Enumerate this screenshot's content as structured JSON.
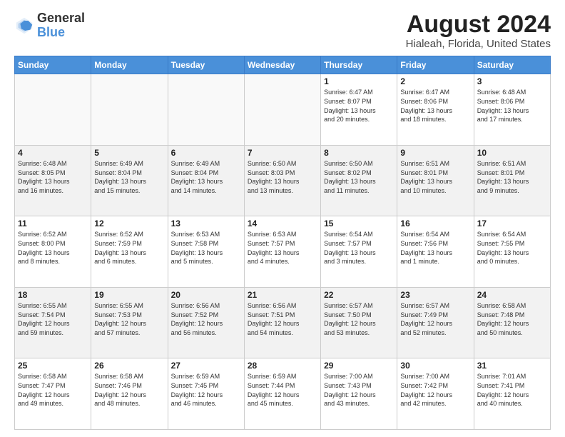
{
  "logo": {
    "line1": "General",
    "line2": "Blue"
  },
  "title": "August 2024",
  "subtitle": "Hialeah, Florida, United States",
  "days_of_week": [
    "Sunday",
    "Monday",
    "Tuesday",
    "Wednesday",
    "Thursday",
    "Friday",
    "Saturday"
  ],
  "weeks": [
    [
      {
        "day": "",
        "info": ""
      },
      {
        "day": "",
        "info": ""
      },
      {
        "day": "",
        "info": ""
      },
      {
        "day": "",
        "info": ""
      },
      {
        "day": "1",
        "info": "Sunrise: 6:47 AM\nSunset: 8:07 PM\nDaylight: 13 hours\nand 20 minutes."
      },
      {
        "day": "2",
        "info": "Sunrise: 6:47 AM\nSunset: 8:06 PM\nDaylight: 13 hours\nand 18 minutes."
      },
      {
        "day": "3",
        "info": "Sunrise: 6:48 AM\nSunset: 8:06 PM\nDaylight: 13 hours\nand 17 minutes."
      }
    ],
    [
      {
        "day": "4",
        "info": "Sunrise: 6:48 AM\nSunset: 8:05 PM\nDaylight: 13 hours\nand 16 minutes."
      },
      {
        "day": "5",
        "info": "Sunrise: 6:49 AM\nSunset: 8:04 PM\nDaylight: 13 hours\nand 15 minutes."
      },
      {
        "day": "6",
        "info": "Sunrise: 6:49 AM\nSunset: 8:04 PM\nDaylight: 13 hours\nand 14 minutes."
      },
      {
        "day": "7",
        "info": "Sunrise: 6:50 AM\nSunset: 8:03 PM\nDaylight: 13 hours\nand 13 minutes."
      },
      {
        "day": "8",
        "info": "Sunrise: 6:50 AM\nSunset: 8:02 PM\nDaylight: 13 hours\nand 11 minutes."
      },
      {
        "day": "9",
        "info": "Sunrise: 6:51 AM\nSunset: 8:01 PM\nDaylight: 13 hours\nand 10 minutes."
      },
      {
        "day": "10",
        "info": "Sunrise: 6:51 AM\nSunset: 8:01 PM\nDaylight: 13 hours\nand 9 minutes."
      }
    ],
    [
      {
        "day": "11",
        "info": "Sunrise: 6:52 AM\nSunset: 8:00 PM\nDaylight: 13 hours\nand 8 minutes."
      },
      {
        "day": "12",
        "info": "Sunrise: 6:52 AM\nSunset: 7:59 PM\nDaylight: 13 hours\nand 6 minutes."
      },
      {
        "day": "13",
        "info": "Sunrise: 6:53 AM\nSunset: 7:58 PM\nDaylight: 13 hours\nand 5 minutes."
      },
      {
        "day": "14",
        "info": "Sunrise: 6:53 AM\nSunset: 7:57 PM\nDaylight: 13 hours\nand 4 minutes."
      },
      {
        "day": "15",
        "info": "Sunrise: 6:54 AM\nSunset: 7:57 PM\nDaylight: 13 hours\nand 3 minutes."
      },
      {
        "day": "16",
        "info": "Sunrise: 6:54 AM\nSunset: 7:56 PM\nDaylight: 13 hours\nand 1 minute."
      },
      {
        "day": "17",
        "info": "Sunrise: 6:54 AM\nSunset: 7:55 PM\nDaylight: 13 hours\nand 0 minutes."
      }
    ],
    [
      {
        "day": "18",
        "info": "Sunrise: 6:55 AM\nSunset: 7:54 PM\nDaylight: 12 hours\nand 59 minutes."
      },
      {
        "day": "19",
        "info": "Sunrise: 6:55 AM\nSunset: 7:53 PM\nDaylight: 12 hours\nand 57 minutes."
      },
      {
        "day": "20",
        "info": "Sunrise: 6:56 AM\nSunset: 7:52 PM\nDaylight: 12 hours\nand 56 minutes."
      },
      {
        "day": "21",
        "info": "Sunrise: 6:56 AM\nSunset: 7:51 PM\nDaylight: 12 hours\nand 54 minutes."
      },
      {
        "day": "22",
        "info": "Sunrise: 6:57 AM\nSunset: 7:50 PM\nDaylight: 12 hours\nand 53 minutes."
      },
      {
        "day": "23",
        "info": "Sunrise: 6:57 AM\nSunset: 7:49 PM\nDaylight: 12 hours\nand 52 minutes."
      },
      {
        "day": "24",
        "info": "Sunrise: 6:58 AM\nSunset: 7:48 PM\nDaylight: 12 hours\nand 50 minutes."
      }
    ],
    [
      {
        "day": "25",
        "info": "Sunrise: 6:58 AM\nSunset: 7:47 PM\nDaylight: 12 hours\nand 49 minutes."
      },
      {
        "day": "26",
        "info": "Sunrise: 6:58 AM\nSunset: 7:46 PM\nDaylight: 12 hours\nand 48 minutes."
      },
      {
        "day": "27",
        "info": "Sunrise: 6:59 AM\nSunset: 7:45 PM\nDaylight: 12 hours\nand 46 minutes."
      },
      {
        "day": "28",
        "info": "Sunrise: 6:59 AM\nSunset: 7:44 PM\nDaylight: 12 hours\nand 45 minutes."
      },
      {
        "day": "29",
        "info": "Sunrise: 7:00 AM\nSunset: 7:43 PM\nDaylight: 12 hours\nand 43 minutes."
      },
      {
        "day": "30",
        "info": "Sunrise: 7:00 AM\nSunset: 7:42 PM\nDaylight: 12 hours\nand 42 minutes."
      },
      {
        "day": "31",
        "info": "Sunrise: 7:01 AM\nSunset: 7:41 PM\nDaylight: 12 hours\nand 40 minutes."
      }
    ]
  ]
}
